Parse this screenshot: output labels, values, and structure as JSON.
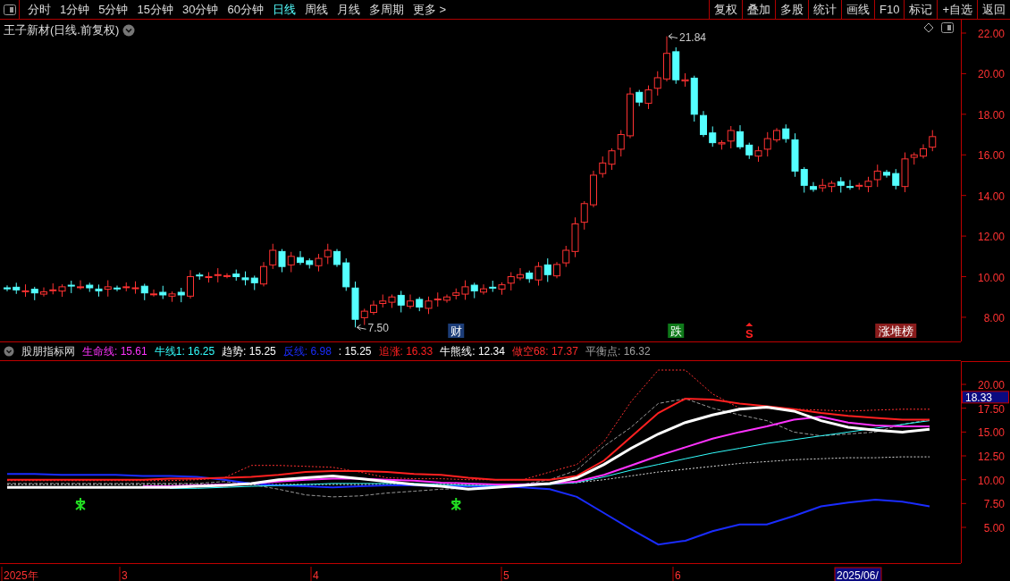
{
  "toolbar": {
    "periods": [
      {
        "label": "分时",
        "selected": false
      },
      {
        "label": "1分钟",
        "selected": false
      },
      {
        "label": "5分钟",
        "selected": false
      },
      {
        "label": "15分钟",
        "selected": false
      },
      {
        "label": "30分钟",
        "selected": false
      },
      {
        "label": "60分钟",
        "selected": false
      },
      {
        "label": "日线",
        "selected": true
      },
      {
        "label": "周线",
        "selected": false
      },
      {
        "label": "月线",
        "selected": false
      },
      {
        "label": "多周期",
        "selected": false
      },
      {
        "label": "更多 >",
        "selected": false
      }
    ],
    "actions": [
      "复权",
      "叠加",
      "多股",
      "统计",
      "画线",
      "F10",
      "标记",
      "+自选",
      "返回"
    ]
  },
  "price_panel": {
    "title": "王子新材(日线.前复权)",
    "high_label": "21.84",
    "low_label": "7.50",
    "signals": [
      {
        "text": "财",
        "kind": "tag",
        "color": "#1c3d78"
      },
      {
        "text": "跌",
        "kind": "tag",
        "color": "#0f7a1a"
      },
      {
        "text": "S",
        "kind": "plain",
        "color": "#ff2020"
      },
      {
        "text": "涨堆榜",
        "kind": "tag",
        "color": "#8a1c1c"
      }
    ]
  },
  "price_axis": {
    "labels": [
      "22.00",
      "20.00",
      "18.00",
      "16.00",
      "14.00",
      "12.00",
      "10.00",
      "8.00"
    ]
  },
  "indicator": {
    "name": "股朋指标网",
    "legend": [
      {
        "text": "生命线: 15.61",
        "color": "#ff33ff"
      },
      {
        "text": "牛线1: 16.25",
        "color": "#33ffff"
      },
      {
        "text": "趋势: 15.25",
        "color": "#ffffff"
      },
      {
        "text": "反线: 6.98",
        "color": "#1a2cff"
      },
      {
        "text": ": 15.25",
        "color": "#ffffff"
      },
      {
        "text": "追涨: 16.33",
        "color": "#ff2020"
      },
      {
        "text": "牛熊线: 12.34",
        "color": "#ffffff"
      },
      {
        "text": "做空68: 17.37",
        "color": "#ff2a2a"
      },
      {
        "text": "平衡点: 16.32",
        "color": "#a0a0a0"
      }
    ],
    "chart_data": {
      "type": "line",
      "ylim": [
        1.25,
        22.44
      ],
      "yticks": [
        {
          "value": 20,
          "label": "20.00"
        },
        {
          "value": 17.5,
          "label": "17.50"
        },
        {
          "value": 15,
          "label": "15.00"
        },
        {
          "value": 12.5,
          "label": "12.50"
        },
        {
          "value": 10,
          "label": "10.00"
        },
        {
          "value": 7.5,
          "label": "7.50"
        },
        {
          "value": 5,
          "label": "5.00"
        }
      ],
      "series": [
        {
          "color": "#ff3030",
          "line_style": "dotted",
          "values": [
            9.9,
            9.9,
            9.9,
            9.9,
            9.9,
            9.9,
            9.9,
            10.0,
            10.2,
            11.5,
            11.5,
            11.4,
            11.3,
            10.8,
            10.2,
            10.1,
            10.1,
            10.0,
            10.0,
            10.0,
            10.8,
            11.6,
            14.0,
            18.2,
            21.5,
            21.5,
            19.0,
            17.5,
            17.5,
            17.4,
            17.3,
            17.2,
            17.3,
            17.4,
            17.4
          ]
        },
        {
          "color": "#999999",
          "line_style": "dashed",
          "values": [
            9.6,
            9.6,
            9.6,
            9.6,
            9.6,
            9.6,
            9.6,
            9.6,
            9.8,
            9.5,
            9.0,
            8.4,
            8.2,
            8.3,
            8.6,
            8.8,
            9.0,
            9.1,
            9.2,
            9.5,
            10.0,
            11.0,
            13.5,
            15.5,
            18.0,
            18.5,
            17.5,
            16.8,
            16.2,
            15.0,
            14.6,
            14.8,
            15.0,
            15.8,
            16.3
          ]
        },
        {
          "color": "#dddddd",
          "line_style": "dotted",
          "values": [
            9.5,
            9.5,
            9.5,
            9.5,
            9.5,
            9.5,
            9.5,
            9.5,
            9.5,
            9.5,
            9.5,
            9.5,
            9.5,
            9.5,
            9.5,
            9.5,
            9.5,
            9.5,
            9.5,
            9.5,
            9.6,
            9.7,
            10.0,
            10.4,
            10.8,
            11.1,
            11.4,
            11.7,
            11.9,
            12.1,
            12.2,
            12.3,
            12.3,
            12.4,
            12.4
          ]
        },
        {
          "color": "#1a2cff",
          "values": [
            10.6,
            10.6,
            10.5,
            10.5,
            10.5,
            10.4,
            10.4,
            10.3,
            10.0,
            9.6,
            9.4,
            9.3,
            9.2,
            9.3,
            9.4,
            9.4,
            9.3,
            9.3,
            9.3,
            9.2,
            9.0,
            8.2,
            6.5,
            4.8,
            3.2,
            3.6,
            4.6,
            5.3,
            5.3,
            6.2,
            7.2,
            7.6,
            7.9,
            7.7,
            7.2
          ]
        },
        {
          "color": "#33ffff",
          "values": [
            null,
            null,
            null,
            null,
            null,
            null,
            9.1,
            9.1,
            9.2,
            9.3,
            9.4,
            9.5,
            9.6,
            9.6,
            9.6,
            9.6,
            9.5,
            9.4,
            9.4,
            9.4,
            9.5,
            9.7,
            10.3,
            11.0,
            11.6,
            12.2,
            12.8,
            13.3,
            13.8,
            14.2,
            14.6,
            15.0,
            15.4,
            15.8,
            16.2
          ]
        },
        {
          "color": "#ff33ff",
          "values": [
            null,
            null,
            null,
            null,
            null,
            9.3,
            9.3,
            9.4,
            9.5,
            9.6,
            9.8,
            10.0,
            10.1,
            10.1,
            10.0,
            9.9,
            9.7,
            9.6,
            9.5,
            9.5,
            9.6,
            9.8,
            10.5,
            11.5,
            12.5,
            13.4,
            14.3,
            15.0,
            15.6,
            16.3,
            16.6,
            16.0,
            15.7,
            15.6,
            15.6
          ]
        },
        {
          "color": "#ff2020",
          "values": [
            10.0,
            10.0,
            10.0,
            10.0,
            10.0,
            10.0,
            10.1,
            10.1,
            10.2,
            10.3,
            10.5,
            10.8,
            10.9,
            10.9,
            10.8,
            10.6,
            10.5,
            10.2,
            10.0,
            10.0,
            10.0,
            10.4,
            12.0,
            14.5,
            17.0,
            18.5,
            18.4,
            18.0,
            17.7,
            17.4,
            17.0,
            16.7,
            16.5,
            16.3,
            16.3
          ]
        },
        {
          "color": "#ffffff",
          "values": [
            9.2,
            9.2,
            9.2,
            9.2,
            9.2,
            9.2,
            9.2,
            9.3,
            9.4,
            9.6,
            10.0,
            10.2,
            10.4,
            10.1,
            9.8,
            9.5,
            9.3,
            9.0,
            9.2,
            9.4,
            9.6,
            10.2,
            11.6,
            13.3,
            14.8,
            16.0,
            16.8,
            17.4,
            17.6,
            17.2,
            16.2,
            15.5,
            15.2,
            15.0,
            15.3
          ]
        }
      ]
    }
  },
  "indicator_axis": {
    "current_value": "18.33"
  },
  "date_axis": {
    "labels": [
      "2025年",
      "3",
      "4",
      "5",
      "6"
    ],
    "cursor_label": "2025/06/"
  }
}
